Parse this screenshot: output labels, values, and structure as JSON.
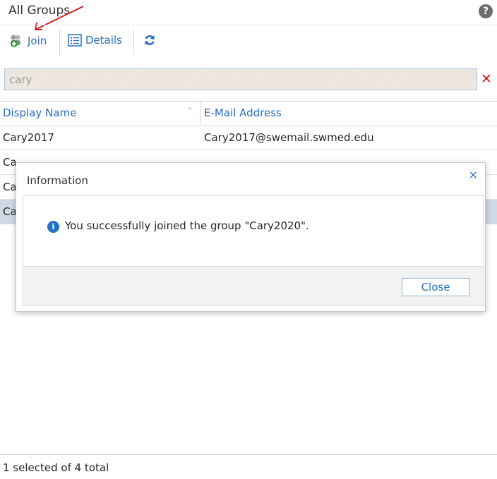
{
  "panel": {
    "title": "All Groups",
    "help_icon": "?"
  },
  "toolbar": {
    "join_label": "Join",
    "details_label": "Details"
  },
  "search": {
    "value": "cary",
    "clear_icon": "✕"
  },
  "grid": {
    "col_display_name": "Display Name",
    "col_email": "E-Mail Address",
    "rows": [
      {
        "name": "Cary2017",
        "email": "Cary2017@swemail.swmed.edu"
      },
      {
        "name": "Ca",
        "email": ""
      },
      {
        "name": "Ca",
        "email": ""
      },
      {
        "name": "Ca",
        "email": ""
      }
    ]
  },
  "status": {
    "text": "1 selected of 4 total"
  },
  "dialog": {
    "title": "Information",
    "close_x": "×",
    "message": "You successfully joined the group \"Cary2020\".",
    "close_button": "Close"
  },
  "colors": {
    "accent": "#2a6ebb",
    "selected_row": "#cfd8e3",
    "clear_red": "#d21a1a",
    "arrow_red": "#d22020"
  },
  "icons": {
    "join": "group-join-icon",
    "details": "details-list-icon",
    "refresh": "refresh-icon",
    "info": "info-icon"
  }
}
